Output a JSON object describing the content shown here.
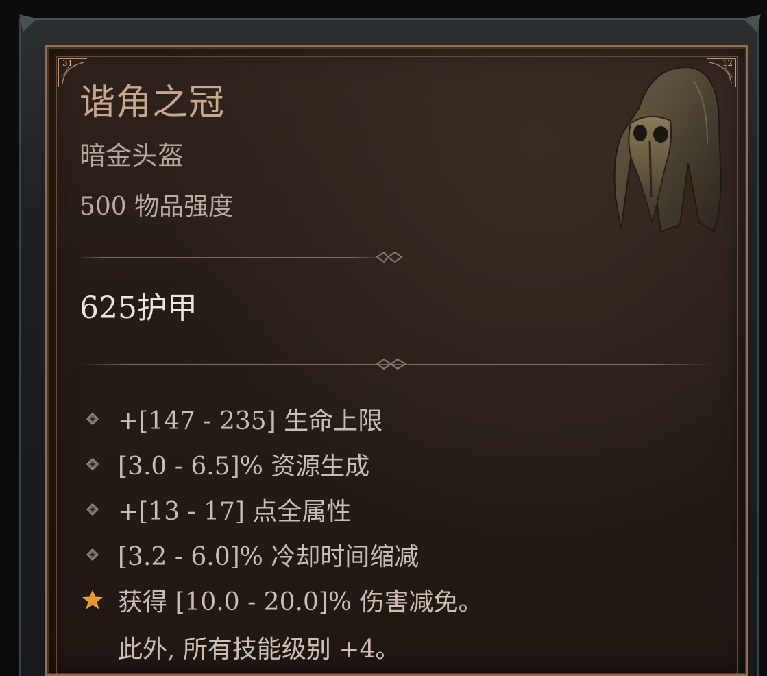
{
  "item": {
    "name": "谐角之冠",
    "type": "暗金头盔",
    "power_value": "500",
    "power_label": "物品强度",
    "armor": "625护甲",
    "corner_left": "31",
    "corner_right": "12"
  },
  "affixes": [
    {
      "text": "+[147 - 235] 生命上限",
      "bullet": "diamond-icon"
    },
    {
      "text": "[3.0 - 6.5]% 资源生成",
      "bullet": "diamond-icon"
    },
    {
      "text": "+[13 - 17] 点全属性",
      "bullet": "diamond-icon"
    },
    {
      "text": "[3.2 - 6.0]% 冷却时间缩减",
      "bullet": "diamond-icon"
    },
    {
      "text": "获得 [10.0 - 20.0]% 伤害减免。",
      "bullet": "star-icon"
    }
  ],
  "legendary_extra": "此外, 所有技能级别 +4。",
  "colors": {
    "name": "#c9a78c",
    "border": "#9a6a4a",
    "star": "#e8962a",
    "background": "#261c17"
  }
}
